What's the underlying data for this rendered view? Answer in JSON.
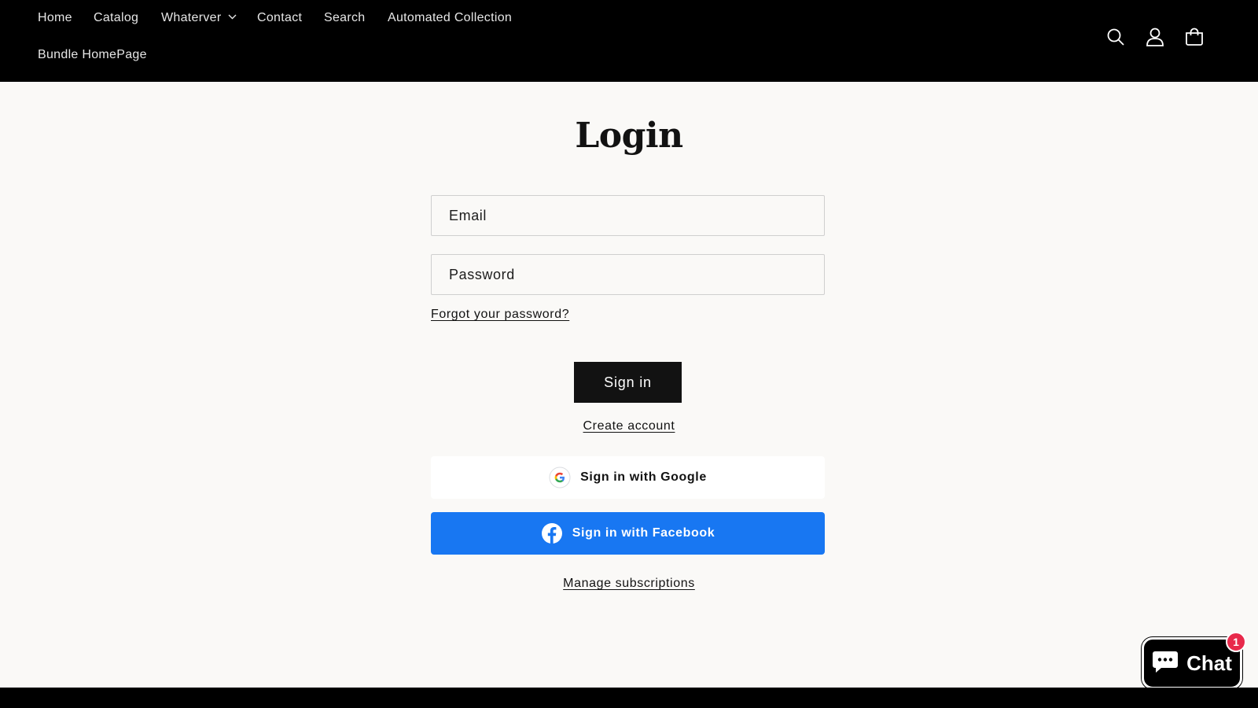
{
  "header": {
    "nav": [
      {
        "label": "Home"
      },
      {
        "label": "Catalog"
      },
      {
        "label": "Whaterver",
        "has_dropdown": true
      },
      {
        "label": "Contact"
      },
      {
        "label": "Search"
      },
      {
        "label": "Automated Collection"
      },
      {
        "label": "Bundle HomePage"
      }
    ],
    "icons": [
      "search-icon",
      "account-icon",
      "cart-icon"
    ]
  },
  "login": {
    "title": "Login",
    "email_placeholder": "Email",
    "password_placeholder": "Password",
    "forgot_label": "Forgot your password?",
    "signin_label": "Sign in",
    "create_account_label": "Create account",
    "google_label": "Sign in with Google",
    "facebook_label": "Sign in with Facebook",
    "manage_label": "Manage subscriptions"
  },
  "chat": {
    "label": "Chat",
    "badge": "1"
  },
  "colors": {
    "header_bg": "#000000",
    "page_bg": "#faf9f7",
    "button_dark": "#121212",
    "facebook_blue": "#1877f2",
    "badge_red": "#e8294b"
  }
}
